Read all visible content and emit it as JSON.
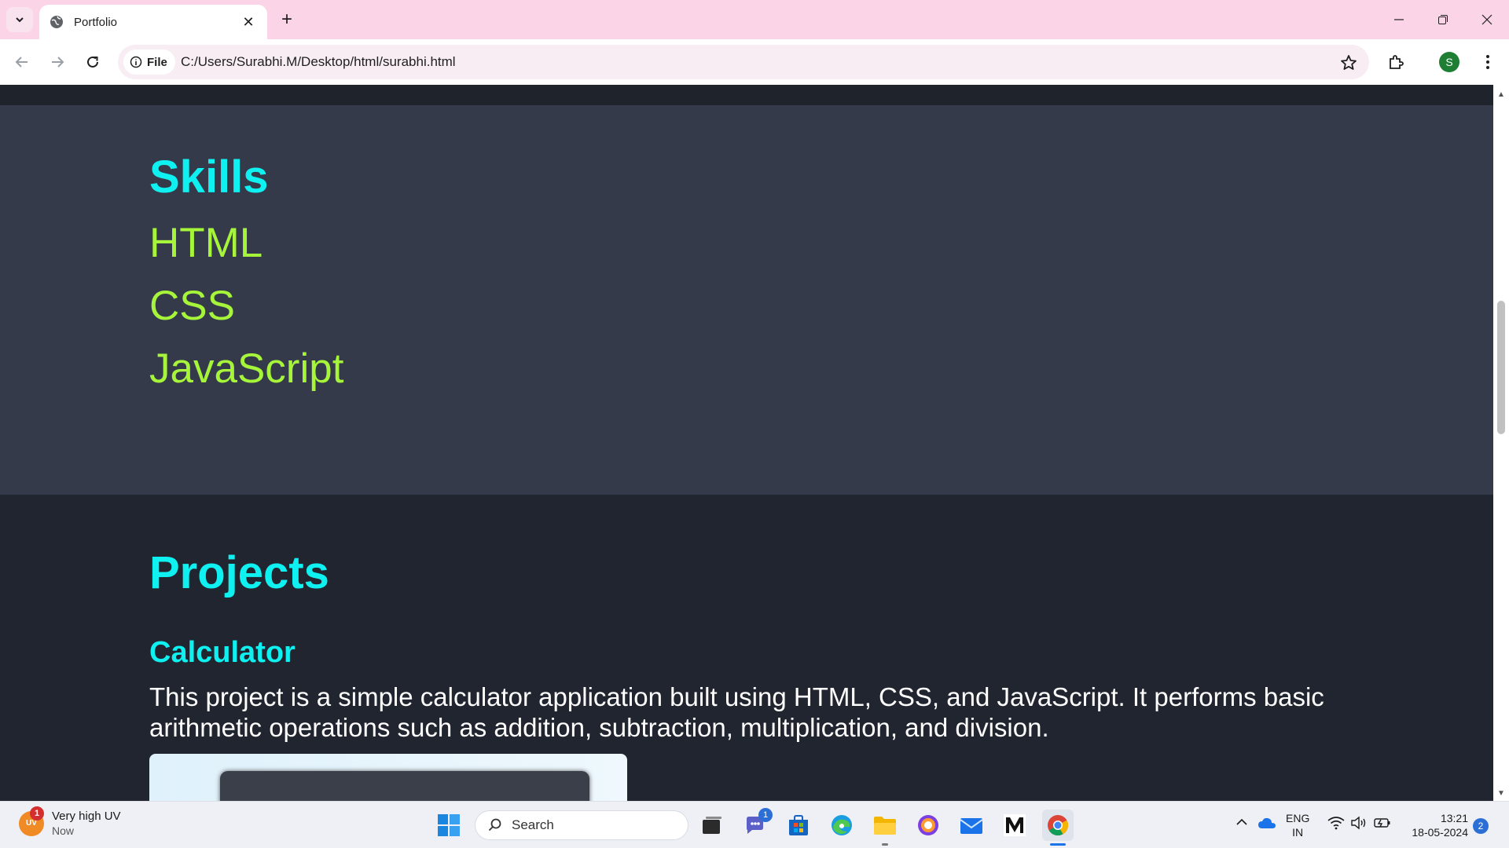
{
  "browser": {
    "tab_title": "Portfolio",
    "address_chip": "File",
    "url": "C:/Users/Surabhi.M/Desktop/html/surabhi.html",
    "profile_initial": "S"
  },
  "page": {
    "skills": {
      "heading": "Skills",
      "items": [
        "HTML",
        "CSS",
        "JavaScript"
      ]
    },
    "projects": {
      "heading": "Projects",
      "items": [
        {
          "title": "Calculator",
          "description": "This project is a simple calculator application built using HTML, CSS, and JavaScript. It performs basic arithmetic operations such as addition, subtraction, multiplication, and division."
        }
      ]
    }
  },
  "taskbar": {
    "weather_title": "Very high UV",
    "weather_sub": "Now",
    "weather_icon_text": "UV",
    "weather_badge": "1",
    "search_label": "Search",
    "teams_badge": "1",
    "lang_line1": "ENG",
    "lang_line2": "IN",
    "time": "13:21",
    "date": "18-05-2024",
    "notification_count": "2"
  },
  "colors": {
    "heading": "#0ff0f0",
    "skill_text": "#a6f53a",
    "skills_bg": "#343a4a",
    "projects_bg": "#212530",
    "tab_strip": "#fbd5e7"
  }
}
